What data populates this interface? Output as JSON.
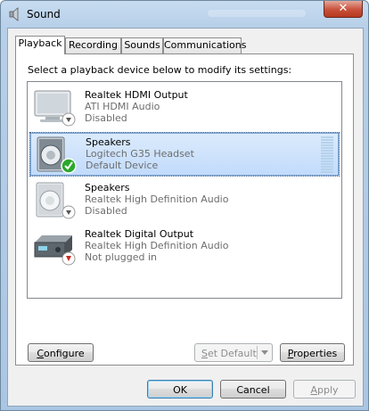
{
  "window": {
    "title": "Sound"
  },
  "tabs": [
    {
      "label": "Playback",
      "active": true
    },
    {
      "label": "Recording",
      "active": false
    },
    {
      "label": "Sounds",
      "active": false
    },
    {
      "label": "Communications",
      "active": false
    }
  ],
  "instruction": "Select a playback device below to modify its settings:",
  "devices": [
    {
      "name": "Realtek HDMI Output",
      "line1": "ATI HDMI Audio",
      "line2": "Disabled",
      "icon": "monitor-icon",
      "status": "disabled"
    },
    {
      "name": "Speakers",
      "line1": "Logitech G35 Headset",
      "line2": "Default Device",
      "icon": "speaker-icon",
      "status": "default",
      "selected": true
    },
    {
      "name": "Speakers",
      "line1": "Realtek High Definition Audio",
      "line2": "Disabled",
      "icon": "speaker-icon",
      "status": "disabled"
    },
    {
      "name": "Realtek Digital Output",
      "line1": "Realtek High Definition Audio",
      "line2": "Not plugged in",
      "icon": "receiver-icon",
      "status": "unplugged"
    }
  ],
  "buttons": {
    "configure_prefix": "",
    "configure_key": "C",
    "configure_rest": "onfigure",
    "setdefault_key": "S",
    "setdefault_rest": "et Default",
    "properties_key": "P",
    "properties_rest": "roperties",
    "ok": "OK",
    "cancel": "Cancel",
    "apply_key": "A",
    "apply_rest": "pply"
  },
  "colors": {
    "accent": "#3c7fb1",
    "selection": "#c1dbfc",
    "check": "#2ba82b",
    "unplugged": "#c8281e"
  }
}
